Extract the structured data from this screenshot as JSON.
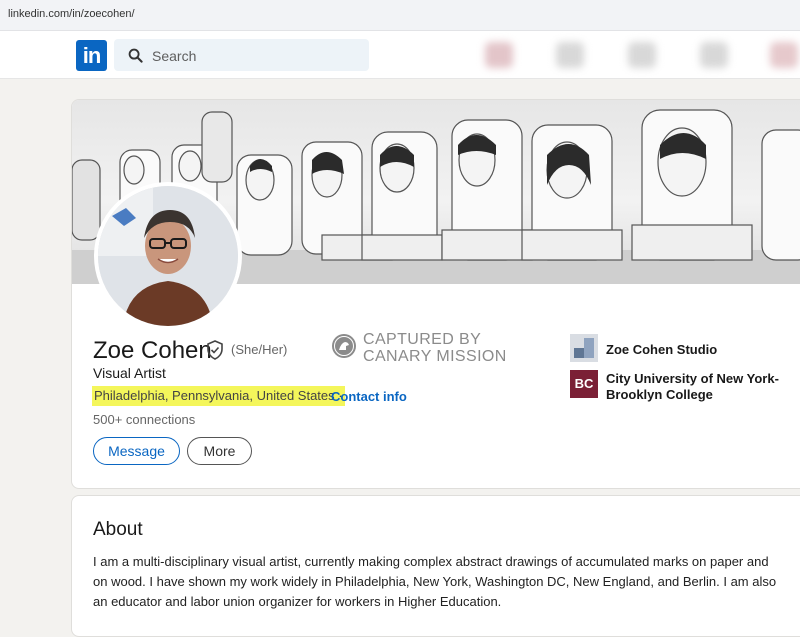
{
  "browser": {
    "url": "linkedin.com/in/zoecohen/"
  },
  "nav": {
    "logo_text": "in",
    "search_placeholder": "Search",
    "icons": [
      "home-icon",
      "network-icon",
      "jobs-icon",
      "messaging-icon",
      "notifications-icon"
    ]
  },
  "profile": {
    "name": "Zoe Cohen",
    "pronouns": "(She/Her)",
    "headline": "Visual Artist",
    "location": "Philadelphia, Pennsylvania, United States ·",
    "contact_label": "Contact info",
    "connections": "500+ connections",
    "stamp_line1": "CAPTURED BY",
    "stamp_line2": "CANARY MISSION",
    "orgs": [
      {
        "name": "Zoe Cohen Studio"
      },
      {
        "name_line1": "City University of New York-",
        "name_line2": "Brooklyn College",
        "logo_text": "BC"
      }
    ]
  },
  "actions": {
    "message_label": "Message",
    "more_label": "More"
  },
  "about": {
    "title": "About",
    "text": "I am a multi-disciplinary visual artist, currently making complex abstract drawings of accumulated marks on paper and on wood. I have shown my work widely in Philadelphia, New York, Washington DC, New England, and Berlin. I am also an educator and labor union organizer for workers in Higher Education."
  },
  "colors": {
    "brand": "#0a66c2",
    "highlight": "#f4f65b",
    "college": "#7b2036"
  }
}
